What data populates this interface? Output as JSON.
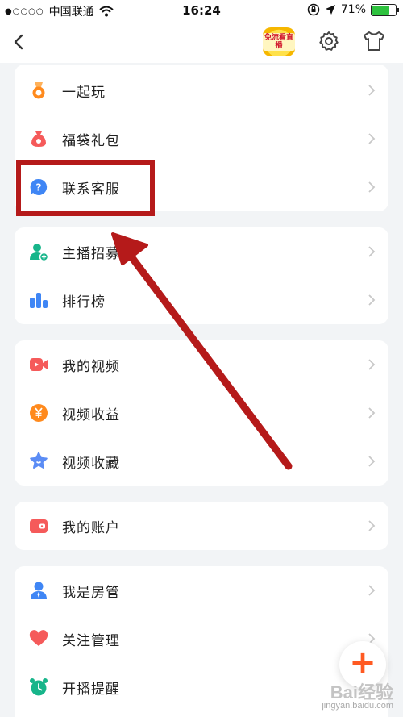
{
  "status_bar": {
    "signal": "●○○○○",
    "carrier": "中国联通",
    "time": "16:24",
    "battery_percent": "71%",
    "battery_level": 0.71
  },
  "nav": {
    "badge_text": "免流看直播"
  },
  "cards": [
    {
      "rows": [
        {
          "label": "一起玩",
          "icon": "medal-icon",
          "color": "#ff8a1d"
        },
        {
          "label": "福袋礼包",
          "icon": "lucky-bag-icon",
          "color": "#f55a5a"
        },
        {
          "label": "联系客服",
          "icon": "help-question-icon",
          "color": "#3f86f5"
        }
      ]
    },
    {
      "rows": [
        {
          "label": "主播招募",
          "icon": "add-user-icon",
          "color": "#17b58a"
        },
        {
          "label": "排行榜",
          "icon": "bar-chart-icon",
          "color": "#3f86f5"
        }
      ]
    },
    {
      "rows": [
        {
          "label": "我的视频",
          "icon": "video-icon",
          "color": "#f55a5a"
        },
        {
          "label": "视频收益",
          "icon": "yuan-coin-icon",
          "color": "#ff8a1d"
        },
        {
          "label": "视频收藏",
          "icon": "star-favorite-icon",
          "color": "#5b8cf5"
        }
      ]
    },
    {
      "rows": [
        {
          "label": "我的账户",
          "icon": "wallet-icon",
          "color": "#f55a5a"
        }
      ]
    },
    {
      "rows": [
        {
          "label": "我是房管",
          "icon": "room-admin-icon",
          "color": "#3f86f5"
        },
        {
          "label": "关注管理",
          "icon": "heart-icon",
          "color": "#f55a5a"
        },
        {
          "label": "开播提醒",
          "icon": "alarm-clock-icon",
          "color": "#17b58a"
        }
      ]
    }
  ],
  "fab": {
    "symbol": "+"
  },
  "watermark": {
    "brand": "Bai",
    "brand_cn": "经验",
    "url": "jingyan.baidu.com"
  },
  "annotation_color": "#b51a1a"
}
